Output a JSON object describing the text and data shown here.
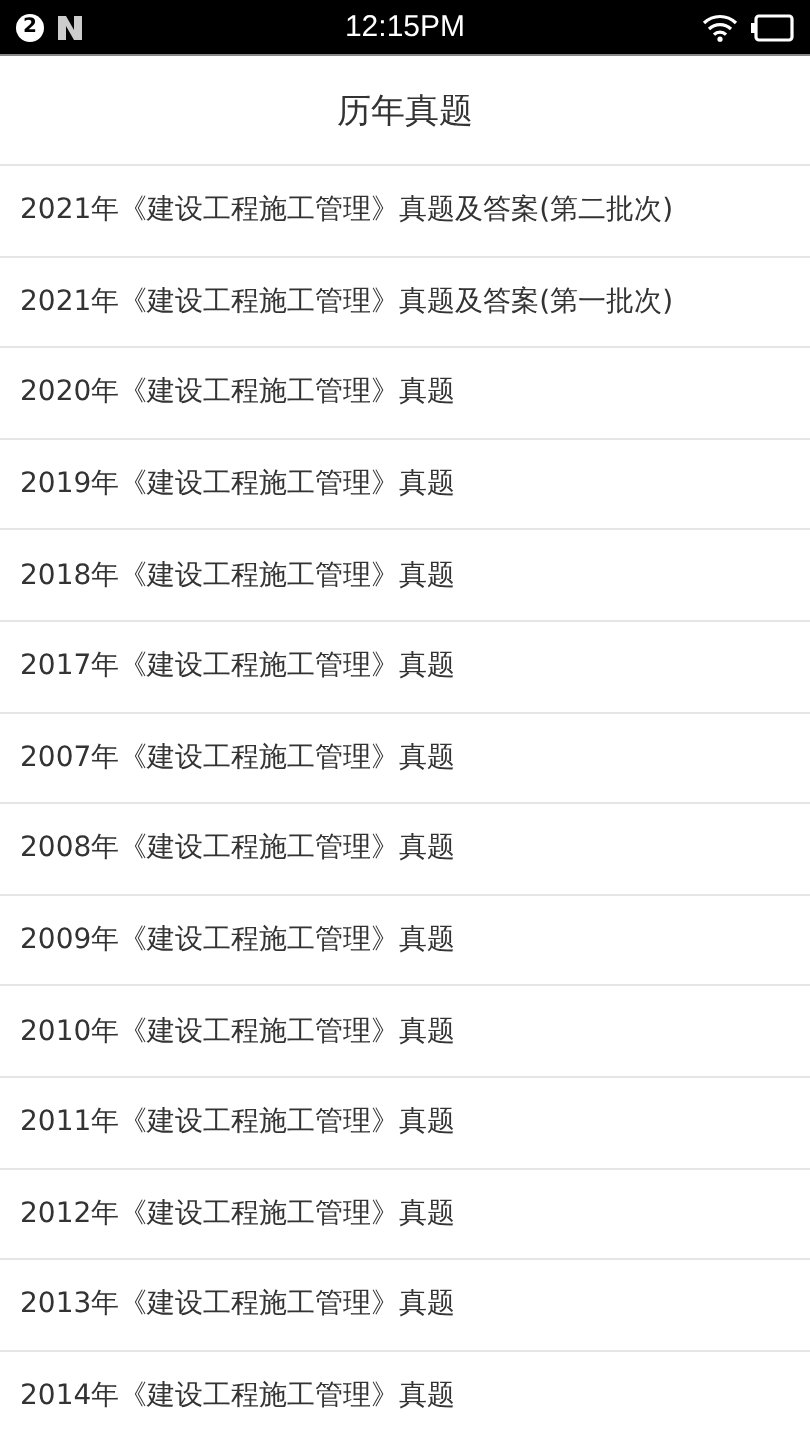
{
  "status_bar": {
    "notification_count": "2",
    "time": "12:15PM"
  },
  "header": {
    "title": "历年真题"
  },
  "items": [
    {
      "label": "2021年《建设工程施工管理》真题及答案(第二批次)"
    },
    {
      "label": "2021年《建设工程施工管理》真题及答案(第一批次)"
    },
    {
      "label": "2020年《建设工程施工管理》真题"
    },
    {
      "label": "2019年《建设工程施工管理》真题"
    },
    {
      "label": "2018年《建设工程施工管理》真题"
    },
    {
      "label": "2017年《建设工程施工管理》真题"
    },
    {
      "label": "2007年《建设工程施工管理》真题"
    },
    {
      "label": "2008年《建设工程施工管理》真题"
    },
    {
      "label": "2009年《建设工程施工管理》真题"
    },
    {
      "label": "2010年《建设工程施工管理》真题"
    },
    {
      "label": "2011年《建设工程施工管理》真题"
    },
    {
      "label": "2012年《建设工程施工管理》真题"
    },
    {
      "label": "2013年《建设工程施工管理》真题"
    },
    {
      "label": "2014年《建设工程施工管理》真题"
    }
  ]
}
